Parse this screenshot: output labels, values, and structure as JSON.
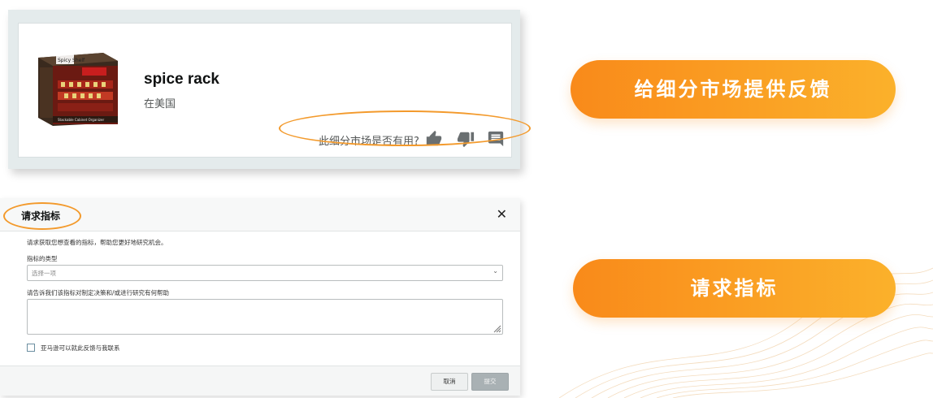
{
  "product_card": {
    "title": "spice rack",
    "subtitle": "在美国",
    "feedback_question": "此细分市场是否有用?",
    "icons": [
      "thumbs-up-icon",
      "thumbs-down-icon",
      "comment-icon"
    ],
    "box_brand_text": "Spicy Shelf",
    "box_caption_text": "Stackable Cabinet Organizer"
  },
  "modal": {
    "title": "请求指标",
    "description": "请求获取您想查看的指标，帮助您更好地研究机会。",
    "type_label": "指标的类型",
    "type_placeholder": "选择一项",
    "help_label": "请告诉我们该指标对制定决策和/或进行研究有何帮助",
    "contact_label": "亚马逊可以就此反馈与我联系",
    "cancel_label": "取消",
    "submit_label": "提交"
  },
  "pills": {
    "feedback_label": "给细分市场提供反馈",
    "request_label": "请求指标"
  },
  "colors": {
    "accent_orange": "#f39a2c",
    "pill_start": "#f98a1a",
    "pill_end": "#fbb12b"
  }
}
